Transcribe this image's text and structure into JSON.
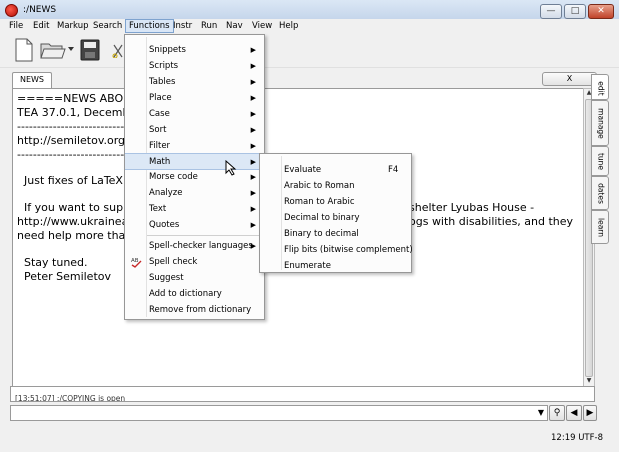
{
  "window": {
    "title": ":/NEWS",
    "controls": {
      "minimize": "—",
      "maximize": "□",
      "close": "✕"
    }
  },
  "menubar": {
    "items": [
      "File",
      "Edit",
      "Markup",
      "Search",
      "Functions",
      "Instr",
      "Run",
      "Nav",
      "View",
      "Help"
    ],
    "active": "Functions"
  },
  "toolbar": {
    "icons": [
      "new-file-icon",
      "open-folder-icon",
      "dropdown-arrow-icon",
      "save-icon"
    ]
  },
  "document": {
    "tab_label": "NEWS",
    "close_tab_label": "X",
    "lines": [
      "=====NEWS ABOU",
      "TEA 37.0.1, December",
      "-----------------------------",
      "http://semiletov.org/t",
      "------------------------------",
      "",
      "  Just fixes of LaTeX",
      "",
      "  If you want to supp",
      "http://www.ukrainea",
      "need help more than",
      "",
      "  Stay tuned.",
      "  Peter Semiletov"
    ],
    "right_fragment_1": "shelter Lyubas House -",
    "right_fragment_2": "ogs with disabilities, and they"
  },
  "side_tabs": [
    "edit",
    "manage",
    "tune",
    "dates",
    "learn"
  ],
  "log": {
    "text": "[13:51:07] :/COPYING is open"
  },
  "status": {
    "text": "12:19 UTF-8"
  },
  "functions_menu": {
    "items": [
      {
        "label": "Snippets",
        "submenu": true
      },
      {
        "label": "Scripts",
        "submenu": true
      },
      {
        "label": "Tables",
        "submenu": true
      },
      {
        "label": "Place",
        "submenu": true
      },
      {
        "label": "Case",
        "submenu": true
      },
      {
        "label": "Sort",
        "submenu": true
      },
      {
        "label": "Filter",
        "submenu": true
      },
      {
        "label": "Math",
        "submenu": true,
        "highlighted": true
      },
      {
        "label": "Morse code",
        "submenu": true
      },
      {
        "label": "Analyze",
        "submenu": true
      },
      {
        "label": "Text",
        "submenu": true
      },
      {
        "label": "Quotes",
        "submenu": true
      },
      {
        "label": "Spell-checker languages",
        "submenu": true
      },
      {
        "label": "Spell check",
        "submenu": false
      },
      {
        "label": "Suggest",
        "submenu": false
      },
      {
        "label": "Add to dictionary",
        "submenu": false
      },
      {
        "label": "Remove from dictionary",
        "submenu": false
      }
    ]
  },
  "math_menu": {
    "items": [
      {
        "label": "Evaluate",
        "shortcut": "F4"
      },
      {
        "label": "Arabic to Roman",
        "shortcut": ""
      },
      {
        "label": "Roman to Arabic",
        "shortcut": ""
      },
      {
        "label": "Decimal to binary",
        "shortcut": ""
      },
      {
        "label": "Binary to decimal",
        "shortcut": ""
      },
      {
        "label": "Flip bits (bitwise complement)",
        "shortcut": ""
      },
      {
        "label": "Enumerate",
        "shortcut": ""
      }
    ]
  },
  "spell_icon_label": "AB",
  "colors": {
    "accent": "#dce8f6",
    "close_red": "#c0432a"
  }
}
